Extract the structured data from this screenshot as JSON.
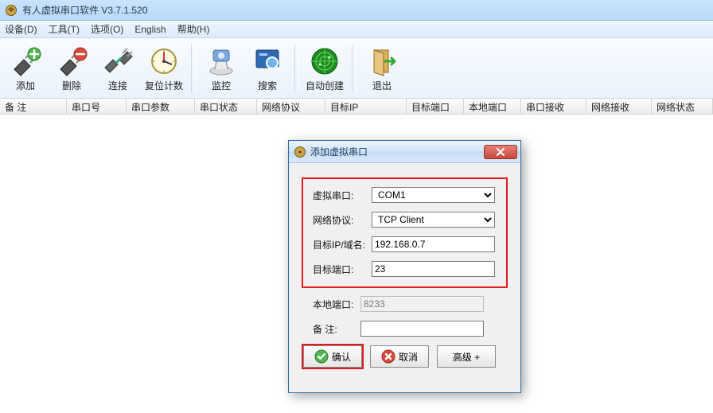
{
  "window": {
    "title": "有人虚拟串口软件 V3.7.1.520"
  },
  "menu": {
    "device": "设备(D)",
    "tools": "工具(T)",
    "options": "选项(O)",
    "english": "English",
    "help": "帮助(H)"
  },
  "toolbar": {
    "add": "添加",
    "delete": "删除",
    "connect": "连接",
    "reset_count": "复位计数",
    "monitor": "监控",
    "search": "搜索",
    "auto_create": "自动创建",
    "exit": "退出"
  },
  "columns": {
    "remark": "备 注",
    "com_no": "串口号",
    "com_params": "串口参数",
    "com_state": "串口状态",
    "net_proto": "网络协议",
    "target_ip": "目标IP",
    "target_port": "目标端口",
    "local_port": "本地端口",
    "com_recv": "串口接收",
    "net_recv": "网络接收",
    "net_state": "网络状态"
  },
  "dialog": {
    "title": "添加虚拟串口",
    "labels": {
      "vcom": "虚拟串口:",
      "proto": "网络协议:",
      "ip": "目标IP/域名:",
      "port": "目标端口:",
      "local_port": "本地端口:",
      "remark": "备 注:"
    },
    "values": {
      "vcom": "COM1",
      "proto": "TCP Client",
      "ip": "192.168.0.7",
      "port": "23",
      "local_port": "8233",
      "remark": ""
    },
    "buttons": {
      "ok": "确认",
      "cancel": "取消",
      "advanced": "高级 +"
    }
  }
}
